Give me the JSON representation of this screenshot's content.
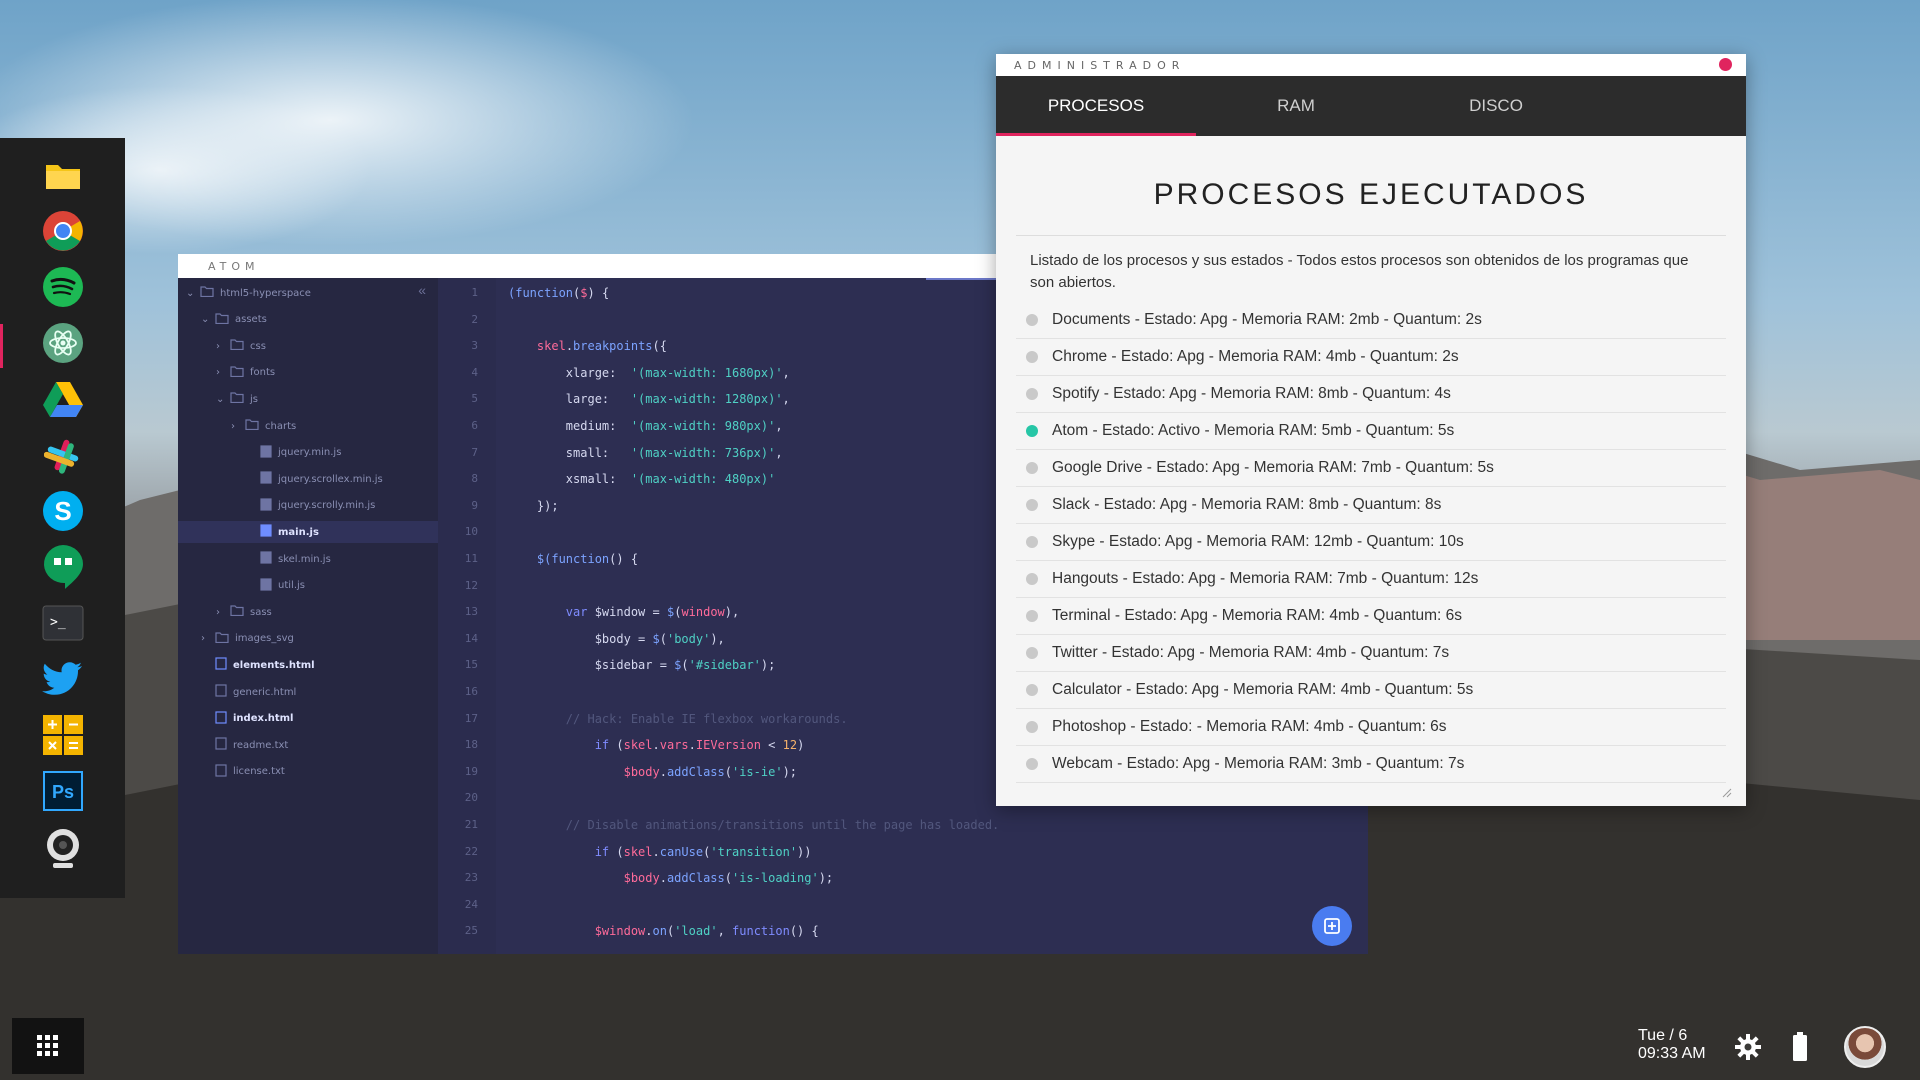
{
  "atom": {
    "title": "ATOM",
    "tree": [
      {
        "label": "html5-hyperspace",
        "kind": "folder-open",
        "indent": 0,
        "arrow": "⌄"
      },
      {
        "label": "assets",
        "kind": "folder-open",
        "indent": 1,
        "arrow": "⌄"
      },
      {
        "label": "css",
        "kind": "folder",
        "indent": 2,
        "arrow": "›"
      },
      {
        "label": "fonts",
        "kind": "folder",
        "indent": 2,
        "arrow": "›"
      },
      {
        "label": "js",
        "kind": "folder-open",
        "indent": 2,
        "arrow": "⌄"
      },
      {
        "label": "charts",
        "kind": "folder",
        "indent": 3,
        "arrow": "›"
      },
      {
        "label": "jquery.min.js",
        "kind": "js",
        "indent": 4,
        "arrow": ""
      },
      {
        "label": "jquery.scrollex.min.js",
        "kind": "js",
        "indent": 4,
        "arrow": ""
      },
      {
        "label": "jquery.scrolly.min.js",
        "kind": "js",
        "indent": 4,
        "arrow": ""
      },
      {
        "label": "main.js",
        "kind": "js-active",
        "indent": 4,
        "arrow": ""
      },
      {
        "label": "skel.min.js",
        "kind": "js",
        "indent": 4,
        "arrow": ""
      },
      {
        "label": "util.js",
        "kind": "js",
        "indent": 4,
        "arrow": ""
      },
      {
        "label": "sass",
        "kind": "folder",
        "indent": 2,
        "arrow": "›"
      },
      {
        "label": "images_svg",
        "kind": "folder",
        "indent": 1,
        "arrow": "›"
      },
      {
        "label": "elements.html",
        "kind": "html-active",
        "indent": 1,
        "arrow": ""
      },
      {
        "label": "generic.html",
        "kind": "html",
        "indent": 1,
        "arrow": ""
      },
      {
        "label": "index.html",
        "kind": "html-active",
        "indent": 1,
        "arrow": ""
      },
      {
        "label": "readme.txt",
        "kind": "txt",
        "indent": 1,
        "arrow": ""
      },
      {
        "label": "license.txt",
        "kind": "txt",
        "indent": 1,
        "arrow": ""
      }
    ],
    "collapse_glyph": "«",
    "code": [
      {
        "n": "1",
        "html": "<span class='tok-fn'>(function</span>(<span class='tok-var'>$</span>) {"
      },
      {
        "n": "2",
        "html": ""
      },
      {
        "n": "3",
        "html": "    <span class='tok-var'>skel</span>.<span class='tok-fn'>breakpoints</span>({"
      },
      {
        "n": "4",
        "html": "        xlarge:  <span class='tok-str'>'(max-width: 1680px)'</span>,"
      },
      {
        "n": "5",
        "html": "        large:   <span class='tok-str'>'(max-width: 1280px)'</span>,"
      },
      {
        "n": "6",
        "html": "        medium:  <span class='tok-str'>'(max-width: 980px)'</span>,"
      },
      {
        "n": "7",
        "html": "        small:   <span class='tok-str'>'(max-width: 736px)'</span>,"
      },
      {
        "n": "8",
        "html": "        xsmall:  <span class='tok-str'>'(max-width: 480px)'</span>"
      },
      {
        "n": "9",
        "html": "    });"
      },
      {
        "n": "10",
        "html": ""
      },
      {
        "n": "11",
        "html": "    <span class='tok-fn'>$(function</span>() {"
      },
      {
        "n": "12",
        "html": ""
      },
      {
        "n": "13",
        "html": "        <span class='tok-kw'>var</span> $window = <span class='tok-fn'>$</span>(<span class='tok-var'>window</span>),"
      },
      {
        "n": "14",
        "html": "            $body = <span class='tok-fn'>$</span>(<span class='tok-str'>'body'</span>),"
      },
      {
        "n": "15",
        "html": "            $sidebar = <span class='tok-fn'>$</span>(<span class='tok-str'>'#sidebar'</span>);"
      },
      {
        "n": "16",
        "html": ""
      },
      {
        "n": "17",
        "html": "        <span class='tok-cm'>// Hack: Enable IE flexbox workarounds.</span>"
      },
      {
        "n": "18",
        "html": "            <span class='tok-kw'>if</span> (<span class='tok-var'>skel</span>.<span class='tok-var'>vars</span>.<span class='tok-var'>IEVersion</span> &lt; <span class='tok-num'>12</span>)"
      },
      {
        "n": "19",
        "html": "                <span class='tok-var'>$body</span>.<span class='tok-fn'>addClass</span>(<span class='tok-str'>'is-ie'</span>);"
      },
      {
        "n": "20",
        "html": ""
      },
      {
        "n": "21",
        "html": "        <span class='tok-cm'>// Disable animations/transitions until the page has loaded.</span>"
      },
      {
        "n": "22",
        "html": "            <span class='tok-kw'>if</span> (<span class='tok-var'>skel</span>.<span class='tok-fn'>canUse</span>(<span class='tok-str'>'transition'</span>))"
      },
      {
        "n": "23",
        "html": "                <span class='tok-var'>$body</span>.<span class='tok-fn'>addClass</span>(<span class='tok-str'>'is-loading'</span>);"
      },
      {
        "n": "24",
        "html": ""
      },
      {
        "n": "25",
        "html": "            <span class='tok-var'>$window</span>.<span class='tok-fn'>on</span>(<span class='tok-str'>'load'</span>, <span class='tok-kw'>function</span>() {"
      }
    ]
  },
  "admin": {
    "title": "ADMINISTRADOR",
    "tabs": [
      "PROCESOS",
      "RAM",
      "DISCO"
    ],
    "active_tab": 0,
    "heading": "PROCESOS EJECUTADOS",
    "description": "Listado de los procesos y sus estados - Todos estos procesos son obtenidos de los programas que son abiertos.",
    "processes": [
      {
        "text": "Documents - Estado: Apg - Memoria RAM: 2mb - Quantum: 2s",
        "active": false
      },
      {
        "text": "Chrome - Estado: Apg - Memoria RAM: 4mb - Quantum: 2s",
        "active": false
      },
      {
        "text": "Spotify - Estado: Apg - Memoria RAM: 8mb - Quantum: 4s",
        "active": false
      },
      {
        "text": "Atom - Estado: Activo - Memoria RAM: 5mb - Quantum: 5s",
        "active": true
      },
      {
        "text": "Google Drive - Estado: Apg - Memoria RAM: 7mb - Quantum: 5s",
        "active": false
      },
      {
        "text": "Slack - Estado: Apg - Memoria RAM: 8mb - Quantum: 8s",
        "active": false
      },
      {
        "text": "Skype - Estado: Apg - Memoria RAM: 12mb - Quantum: 10s",
        "active": false
      },
      {
        "text": "Hangouts - Estado: Apg - Memoria RAM: 7mb - Quantum: 12s",
        "active": false
      },
      {
        "text": "Terminal - Estado: Apg - Memoria RAM: 4mb - Quantum: 6s",
        "active": false
      },
      {
        "text": "Twitter - Estado: Apg - Memoria RAM: 4mb - Quantum: 7s",
        "active": false
      },
      {
        "text": "Calculator - Estado: Apg - Memoria RAM: 4mb - Quantum: 5s",
        "active": false
      },
      {
        "text": "Photoshop - Estado: - Memoria RAM: 4mb - Quantum: 6s",
        "active": false
      },
      {
        "text": "Webcam - Estado: Apg - Memoria RAM: 3mb - Quantum: 7s",
        "active": false
      }
    ],
    "accent_color": "#e0245e",
    "active_dot_color": "#26c6a6"
  },
  "dock": {
    "items": [
      "files-icon",
      "chrome-icon",
      "spotify-icon",
      "atom-icon",
      "google-drive-icon",
      "slack-icon",
      "skype-icon",
      "hangouts-icon",
      "terminal-icon",
      "twitter-icon",
      "calculator-icon",
      "photoshop-icon",
      "webcam-icon"
    ],
    "active_index": 3,
    "terminal_glyph": ">_",
    "photoshop_label": "Ps",
    "skype_label": "S"
  },
  "taskbar": {
    "date": "Tue / 6",
    "time": "09:33 AM",
    "icons": [
      "app-grid-icon",
      "settings-icon",
      "battery-icon",
      "avatar"
    ]
  }
}
